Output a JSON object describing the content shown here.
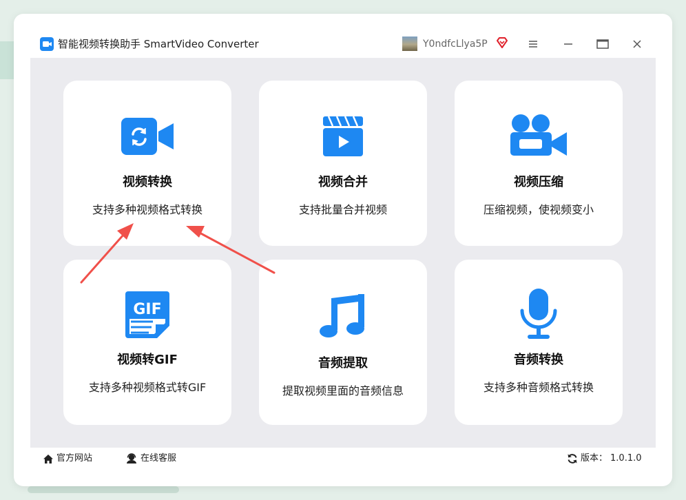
{
  "app": {
    "title": "智能视频转换助手 SmartVideo Converter",
    "username": "Y0ndfcLlya5P",
    "accent_color": "#1e88f2",
    "window_controls": [
      "menu-icon",
      "minimize-icon",
      "maximize-icon",
      "close-icon"
    ]
  },
  "features": [
    {
      "title": "视频转换",
      "desc": "支持多种视频格式转换",
      "icon": "video-convert-icon"
    },
    {
      "title": "视频合并",
      "desc": "支持批量合并视频",
      "icon": "clapperboard-icon"
    },
    {
      "title": "视频压缩",
      "desc": "压缩视频，使视频变小",
      "icon": "video-camera-icon"
    },
    {
      "title": "视频转GIF",
      "desc": "支持多种视频格式转GIF",
      "icon": "gif-file-icon"
    },
    {
      "title": "音频提取",
      "desc": "提取视频里面的音频信息",
      "icon": "music-note-icon"
    },
    {
      "title": "音频转换",
      "desc": "支持多种音频格式转换",
      "icon": "microphone-icon"
    }
  ],
  "footer": {
    "website_label": "官方网站",
    "support_label": "在线客服",
    "version_label": "版本：",
    "version": "1.0.1.0"
  },
  "annotation": {
    "arrow_color": "#f0504a"
  }
}
